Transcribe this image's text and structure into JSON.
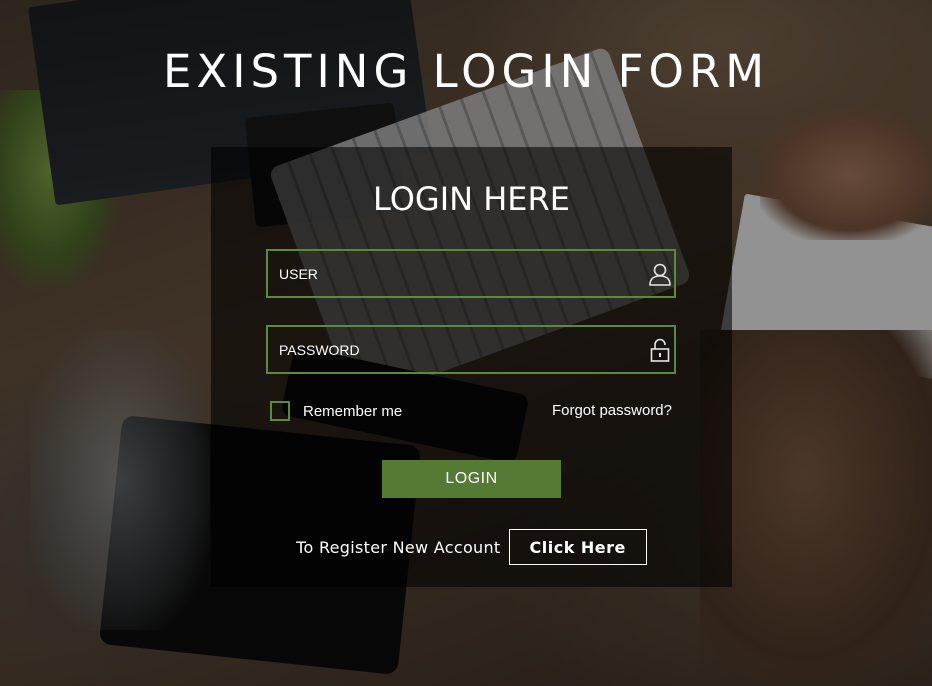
{
  "page": {
    "title": "EXISTING LOGIN FORM"
  },
  "login_panel": {
    "title": "LOGIN HERE",
    "user_field": {
      "placeholder": "USER",
      "value": "",
      "icon": "user-icon"
    },
    "password_field": {
      "placeholder": "PASSWORD",
      "value": "",
      "icon": "lock-icon"
    },
    "remember_me": {
      "label": "Remember me",
      "checked": false
    },
    "forgot_password_label": "Forgot password?",
    "login_button_label": "LOGIN",
    "register": {
      "text": "To Register New Account",
      "button_label": "Click Here"
    }
  },
  "colors": {
    "accent_green": "#557a34",
    "field_border": "#5a8a3a",
    "panel_overlay": "rgba(0,0,0,0.58)",
    "text": "#ffffff"
  }
}
